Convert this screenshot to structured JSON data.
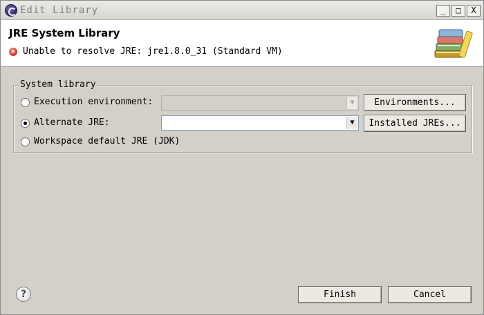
{
  "window": {
    "title": "Edit Library",
    "controls": {
      "minimize": "_",
      "maximize": "□",
      "close": "X"
    }
  },
  "header": {
    "title": "JRE System Library",
    "error_icon": "error-icon",
    "error_glyph": "×",
    "message": "Unable to resolve JRE: jre1.8.0_31 (Standard VM)",
    "banner_icon": "library-books-icon"
  },
  "system_library": {
    "group_label": "System library",
    "options": [
      {
        "label": "Execution environment:",
        "selected": false,
        "combo_value": "",
        "combo_enabled": false,
        "button": "Environments..."
      },
      {
        "label": "Alternate JRE:",
        "selected": true,
        "combo_value": "",
        "combo_enabled": true,
        "button": "Installed JREs..."
      },
      {
        "label": "Workspace default JRE (JDK)",
        "selected": false
      }
    ]
  },
  "footer": {
    "help_glyph": "?",
    "finish_label": "Finish",
    "cancel_label": "Cancel"
  }
}
